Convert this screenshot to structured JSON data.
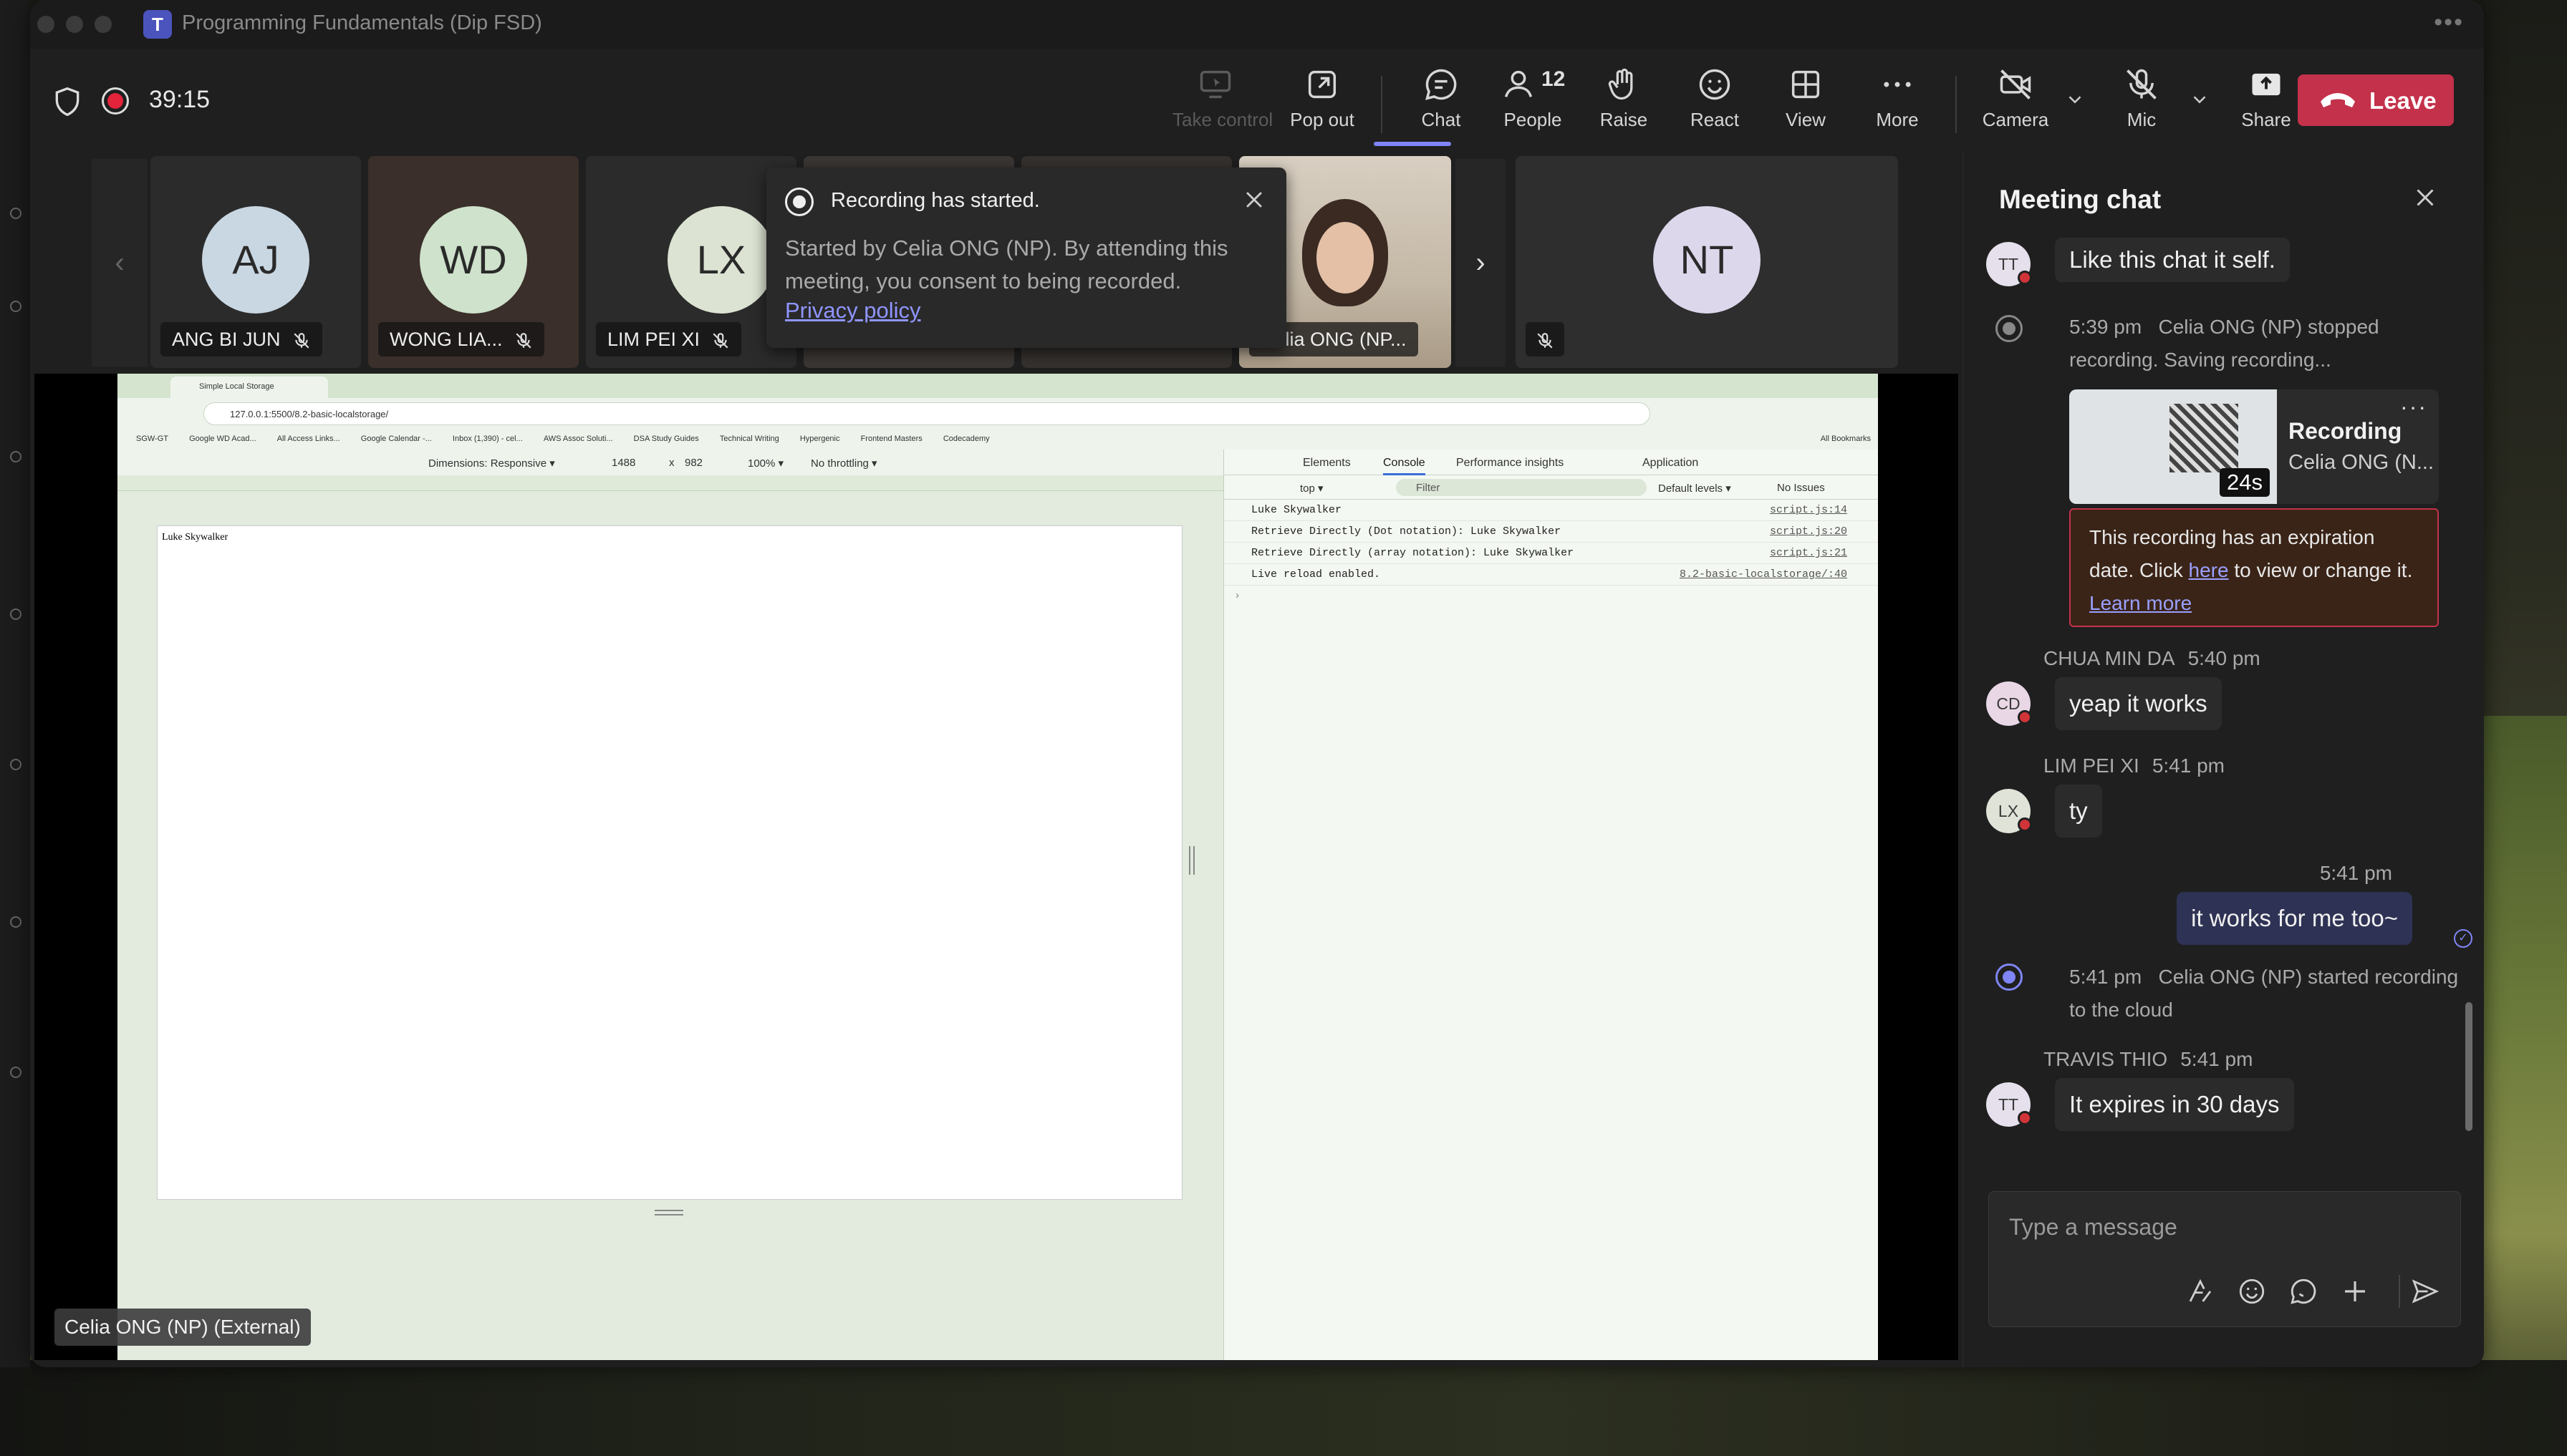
{
  "window": {
    "title": "Programming Fundamentals (Dip FSD)",
    "app_logo": "T"
  },
  "toolbar": {
    "timer": "39:15",
    "take_control": "Take control",
    "pop_out": "Pop out",
    "chat": "Chat",
    "people": "People",
    "people_count": "12",
    "raise": "Raise",
    "react": "React",
    "view": "View",
    "more": "More",
    "camera": "Camera",
    "mic": "Mic",
    "share": "Share",
    "leave": "Leave",
    "leave_color": "#c4314b",
    "accent": "#7f85f5"
  },
  "participants": [
    {
      "initials": "AJ",
      "name": "ANG BI JUN",
      "avatar_color": "#c9d7e2"
    },
    {
      "initials": "WD",
      "name": "WONG LIA...",
      "avatar_color": "#cfe2cc"
    },
    {
      "initials": "LX",
      "name": "LIM PEI XI",
      "avatar_color": "#dce3d2"
    },
    {
      "initials": "",
      "name": "Celia ONG (NP..."
    },
    {
      "initials": "NT",
      "name": "",
      "avatar_color": "#ddd7ec"
    }
  ],
  "toast": {
    "title": "Recording has started.",
    "body": "Started by Celia ONG (NP). By attending this meeting, you consent to being recorded.",
    "link": "Privacy policy"
  },
  "shared_screen": {
    "presenter_label": "Celia ONG (NP) (External)",
    "browser_tab": "Simple Local Storage",
    "url": "127.0.0.1:5500/8.2-basic-localstorage/",
    "bookmarks": [
      "SGW-GT",
      "Google WD Acad...",
      "All Access Links...",
      "Google Calendar -...",
      "Inbox (1,390) - cel...",
      "AWS Assoc Soluti...",
      "DSA Study Guides",
      "Technical Writing",
      "Hypergenic",
      "Frontend Masters",
      "Codecademy"
    ],
    "all_bookmarks": "All Bookmarks",
    "dimensions": "Dimensions: Responsive ▾",
    "width": "1488",
    "height": "982",
    "zoom": "100% ▾",
    "throttling": "No throttling ▾",
    "page_text": "Luke Skywalker",
    "devtools_tabs": [
      "Elements",
      "Console",
      "Performance insights",
      "Application"
    ],
    "console_context": "top ▾",
    "filter": "Filter",
    "levels": "Default levels ▾",
    "issues": "No Issues",
    "console_lines": [
      {
        "msg": "Luke Skywalker",
        "src": "script.js:14"
      },
      {
        "msg": "Retrieve Directly (Dot notation): Luke Skywalker",
        "src": "script.js:20"
      },
      {
        "msg": "Retrieve Directly (array notation): Luke Skywalker",
        "src": "script.js:21"
      },
      {
        "msg": "Live reload enabled.",
        "src": "8.2-basic-localstorage/:40"
      }
    ]
  },
  "chat": {
    "title": "Meeting chat",
    "m1": {
      "initials": "TT",
      "text": "Like this chat it self."
    },
    "sys1": {
      "time": "5:39 pm",
      "text": "Celia ONG (NP) stopped recording. Saving recording..."
    },
    "recording": {
      "title": "Recording",
      "sub": "Celia ONG (N...",
      "duration": "24s"
    },
    "expire": {
      "pre": "This recording has an expiration date. Click",
      "here": "here",
      "mid": "to view or change it.",
      "learn": "Learn more"
    },
    "m2": {
      "sender": "CHUA MIN DA",
      "time": "5:40 pm",
      "initials": "CD",
      "text": "yeap it works"
    },
    "m3": {
      "sender": "LIM PEI XI",
      "time": "5:41 pm",
      "initials": "LX",
      "text": "ty"
    },
    "m4": {
      "time": "5:41 pm",
      "text": "it works for me too~"
    },
    "sys2": {
      "time": "5:41 pm",
      "text": "Celia ONG (NP) started recording to the cloud"
    },
    "m5": {
      "sender": "TRAVIS THIO",
      "time": "5:41 pm",
      "initials": "TT",
      "text": "It expires in 30 days"
    },
    "compose_placeholder": "Type a message"
  }
}
